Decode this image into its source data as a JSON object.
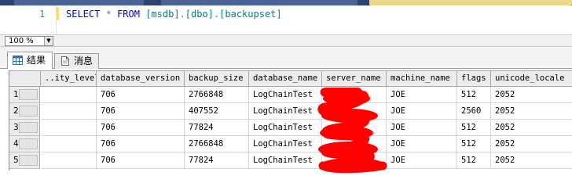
{
  "editor": {
    "line_number": "1",
    "code": {
      "select": "SELECT",
      "star": "*",
      "from": "FROM",
      "db": "[msdb]",
      "dot1": ".",
      "schema": "[dbo]",
      "dot2": ".",
      "table": "[backupset]"
    }
  },
  "zoom": {
    "value": "100 %",
    "dropdown_icon": "triangle-down"
  },
  "results": {
    "tabs": [
      {
        "label": "结果",
        "icon": "grid-icon",
        "active": true
      },
      {
        "label": "消息",
        "icon": "document-icon",
        "active": false
      }
    ],
    "columns": [
      "..ity_level",
      "database_version",
      "backup_size",
      "database_name",
      "server_name",
      "machine_name",
      "flags",
      "unicode_locale"
    ],
    "rows": [
      {
        "row_number": "1",
        "cells": [
          "",
          "706",
          "2766848",
          "LogChainTest",
          "",
          "JOE",
          "512",
          "2052"
        ]
      },
      {
        "row_number": "2",
        "cells": [
          "",
          "706",
          "407552",
          "LogChainTest",
          "",
          "JOE",
          "2560",
          "2052"
        ]
      },
      {
        "row_number": "3",
        "cells": [
          "",
          "706",
          "77824",
          "LogChainTest",
          "",
          "JOE",
          "512",
          "2052"
        ]
      },
      {
        "row_number": "4",
        "cells": [
          "",
          "706",
          "2766848",
          "LogChainTest",
          "",
          "JOE",
          "512",
          "2052"
        ]
      },
      {
        "row_number": "5",
        "cells": [
          "",
          "706",
          "77824",
          "LogChainTest",
          "",
          "JOE",
          "512",
          "2052"
        ]
      }
    ]
  },
  "colors": {
    "keyword": "#0000ff",
    "identifier": "#008080",
    "operator": "#7a7a7a",
    "line_number": "#2b91af",
    "redaction": "#ff0000"
  }
}
